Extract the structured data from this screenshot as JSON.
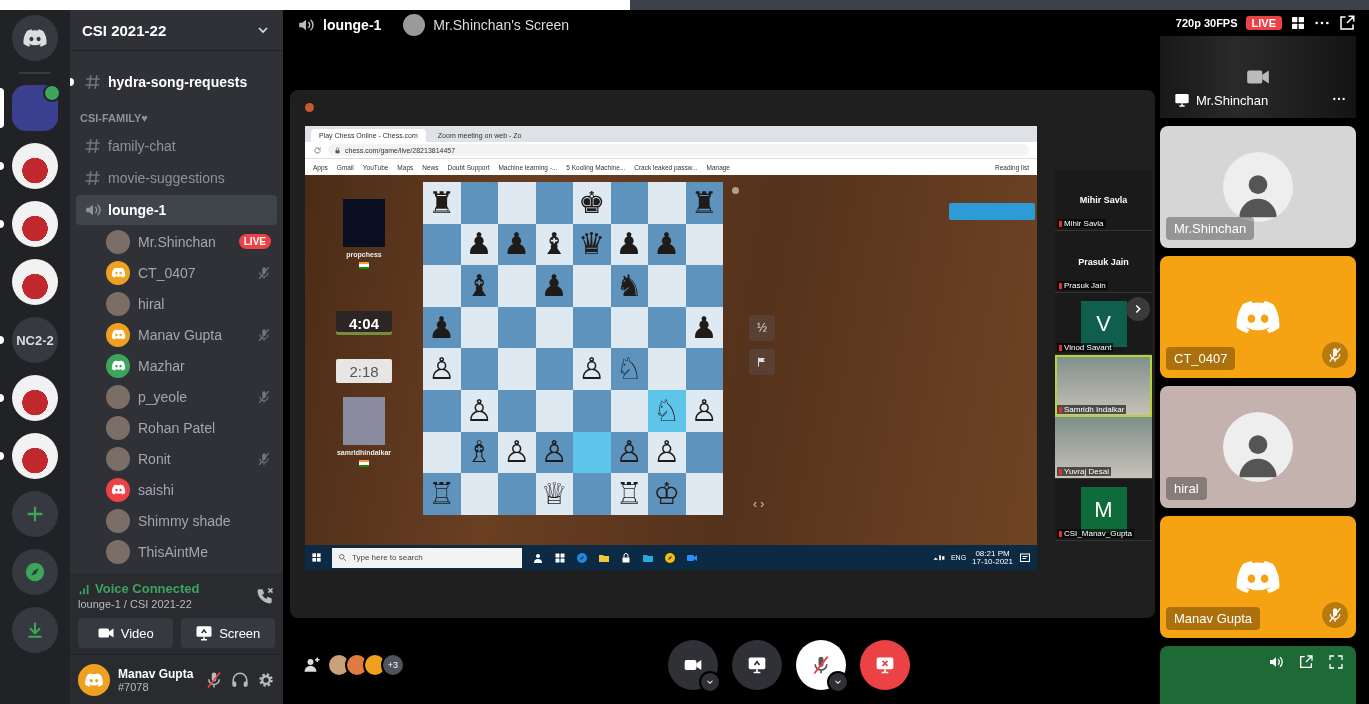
{
  "servers": [
    {
      "kind": "home",
      "selected": false,
      "unread": false,
      "in_voice": false
    },
    {
      "kind": "image",
      "selected": true,
      "unread": false,
      "in_voice": true
    },
    {
      "kind": "image",
      "selected": false,
      "unread": true,
      "in_voice": false
    },
    {
      "kind": "image",
      "selected": false,
      "unread": true,
      "in_voice": false
    },
    {
      "kind": "image",
      "selected": false,
      "unread": false,
      "in_voice": false
    },
    {
      "kind": "text",
      "label": "NC2-2",
      "selected": false,
      "unread": true,
      "in_voice": false
    },
    {
      "kind": "image",
      "selected": false,
      "unread": true,
      "in_voice": false
    },
    {
      "kind": "image",
      "selected": false,
      "unread": true,
      "in_voice": false
    },
    {
      "kind": "add",
      "selected": false,
      "unread": false,
      "in_voice": false
    },
    {
      "kind": "explore",
      "selected": false,
      "unread": false,
      "in_voice": false
    },
    {
      "kind": "download",
      "selected": false,
      "unread": false,
      "in_voice": false
    }
  ],
  "server_name": "CSI 2021-22",
  "channels": [
    {
      "kind": "text",
      "name": "hydra-song-requests",
      "selected": false,
      "unread": true
    }
  ],
  "category": {
    "name": "CSI-FAMILY♥",
    "channels": [
      {
        "kind": "text",
        "name": "family-chat",
        "selected": false,
        "unread": false
      },
      {
        "kind": "text",
        "name": "movie-suggestions",
        "selected": false,
        "unread": false
      },
      {
        "kind": "voice",
        "name": "lounge-1",
        "selected": true,
        "unread": false
      }
    ]
  },
  "members": [
    {
      "name": "Mr.Shinchan",
      "kind": "photo",
      "live": true,
      "live_label": "LIVE",
      "muted": false
    },
    {
      "name": "CT_0407",
      "kind": "discord",
      "color": "#f0a020",
      "live": false,
      "muted": true
    },
    {
      "name": "hiral",
      "kind": "photo",
      "live": false,
      "muted": false
    },
    {
      "name": "Manav Gupta",
      "kind": "discord",
      "color": "#f0a020",
      "live": false,
      "muted": true
    },
    {
      "name": "Mazhar",
      "kind": "discord",
      "color": "#3ba55c",
      "live": false,
      "muted": false
    },
    {
      "name": "p_yeole",
      "kind": "photo",
      "live": false,
      "muted": true
    },
    {
      "name": "Rohan Patel",
      "kind": "photo",
      "live": false,
      "muted": false
    },
    {
      "name": "Ronit",
      "kind": "photo",
      "live": false,
      "muted": true
    },
    {
      "name": "saishi",
      "kind": "discord",
      "color": "#ed4245",
      "live": false,
      "muted": false
    },
    {
      "name": "Shimmy shade",
      "kind": "photo",
      "live": false,
      "muted": false
    },
    {
      "name": "ThisAintMe",
      "kind": "photo",
      "live": false,
      "muted": false
    }
  ],
  "voice_panel": {
    "status": "Voice Connected",
    "channel": "lounge-1 / CSI 2021-22",
    "buttons": [
      {
        "kind": "video",
        "label": "Video"
      },
      {
        "kind": "screen",
        "label": "Screen"
      }
    ]
  },
  "user": {
    "name": "Manav Gupta",
    "tag": "#7078",
    "color": "#f0a020",
    "muted": true
  },
  "header": {
    "channel": "lounge-1",
    "stream_title": "Mr.Shinchan's Screen",
    "quality": "720p 30FPS",
    "live": "LIVE"
  },
  "browser": {
    "tabs": [
      {
        "title": "Play Chess Online - Chess.com",
        "selected": true
      },
      {
        "title": "Zoom meeting on web - Zo",
        "selected": false
      }
    ],
    "url": "chess.com/game/live/28213814457",
    "bookmarks": [
      "Apps",
      "Gmail",
      "YouTube",
      "Maps",
      "News",
      "Doubt Support",
      "Machine learning -...",
      "5 Kooling Machine...",
      "Crack leaked passw...",
      "Manage"
    ],
    "reading_list": "Reading list"
  },
  "chess": {
    "players": [
      {
        "name": "propchess",
        "clock": "4:04",
        "active": false
      },
      {
        "name": "samridhindalkar",
        "clock": "2:18",
        "active": true
      }
    ],
    "draw_button": "½",
    "board": [
      [
        {
          "piece": "♜",
          "highlighted": false
        },
        {
          "highlighted": false
        },
        {
          "highlighted": false
        },
        {
          "highlighted": false
        },
        {
          "piece": "♚",
          "highlighted": false
        },
        {
          "highlighted": false
        },
        {
          "highlighted": false
        },
        {
          "piece": "♜",
          "highlighted": false
        }
      ],
      [
        {
          "highlighted": false
        },
        {
          "piece": "♟",
          "highlighted": false
        },
        {
          "piece": "♟",
          "highlighted": false
        },
        {
          "piece": "♝",
          "highlighted": false
        },
        {
          "piece": "♛",
          "highlighted": false
        },
        {
          "piece": "♟",
          "highlighted": false
        },
        {
          "piece": "♟",
          "highlighted": false
        },
        {
          "highlighted": false
        }
      ],
      [
        {
          "highlighted": false
        },
        {
          "piece": "♝",
          "highlighted": false
        },
        {
          "highlighted": false
        },
        {
          "piece": "♟",
          "highlighted": false
        },
        {
          "highlighted": false
        },
        {
          "piece": "♞",
          "highlighted": false
        },
        {
          "highlighted": false
        },
        {
          "highlighted": false
        }
      ],
      [
        {
          "piece": "♟",
          "highlighted": false
        },
        {
          "highlighted": false
        },
        {
          "highlighted": false
        },
        {
          "highlighted": false
        },
        {
          "highlighted": false
        },
        {
          "highlighted": false
        },
        {
          "highlighted": false
        },
        {
          "piece": "♟",
          "highlighted": false
        }
      ],
      [
        {
          "piece": "♙",
          "highlighted": false
        },
        {
          "highlighted": false
        },
        {
          "highlighted": false
        },
        {
          "highlighted": false
        },
        {
          "piece": "♙",
          "highlighted": false
        },
        {
          "piece": "♘",
          "highlighted": false
        },
        {
          "highlighted": false
        },
        {
          "highlighted": false
        }
      ],
      [
        {
          "highlighted": false
        },
        {
          "piece": "♙",
          "highlighted": false
        },
        {
          "highlighted": false
        },
        {
          "highlighted": false
        },
        {
          "highlighted": false
        },
        {
          "highlighted": false
        },
        {
          "piece": "♘",
          "highlighted": true
        },
        {
          "piece": "♙",
          "highlighted": false
        }
      ],
      [
        {
          "highlighted": false
        },
        {
          "piece": "♗",
          "highlighted": false
        },
        {
          "piece": "♙",
          "highlighted": false
        },
        {
          "piece": "♙",
          "highlighted": false
        },
        {
          "highlighted": true
        },
        {
          "piece": "♙",
          "highlighted": false
        },
        {
          "piece": "♙",
          "highlighted": false
        },
        {
          "highlighted": false
        }
      ],
      [
        {
          "piece": "♖",
          "highlighted": false
        },
        {
          "highlighted": false
        },
        {
          "highlighted": false
        },
        {
          "piece": "♕",
          "highlighted": false
        },
        {
          "highlighted": false
        },
        {
          "piece": "♖",
          "highlighted": false
        },
        {
          "piece": "♔",
          "highlighted": false
        },
        {
          "highlighted": false
        }
      ]
    ],
    "nav": "‹ ›"
  },
  "taskbar": {
    "search_placeholder": "Type here to search",
    "lang": "ENG",
    "time": "08:21 PM",
    "date": "17-10-2021"
  },
  "zoom_panel": [
    {
      "kind": "name",
      "name": "Mihir Savla",
      "label": "Mihir Savla",
      "speaking": false
    },
    {
      "kind": "name",
      "name": "Prasuk Jain",
      "label": "Prasuk Jain",
      "speaking": false
    },
    {
      "kind": "letter",
      "letter": "V",
      "label": "Vinod Savant",
      "color": "#0f5e4e",
      "speaking": false
    },
    {
      "kind": "video",
      "label": "Samridh Indalkar",
      "speaking": true
    },
    {
      "kind": "video",
      "label": "Yuvraj Desai",
      "speaking": false
    },
    {
      "kind": "letter",
      "letter": "M",
      "label": "CSI_Manav_Gupta",
      "color": "#0f6b3a",
      "speaking": false
    }
  ],
  "tiles": [
    {
      "kind": "stream",
      "name": "Mr.Shinchan"
    },
    {
      "kind": "avatar",
      "name": "Mr.Shinchan",
      "color": "#d6d6d6",
      "muted": false
    },
    {
      "kind": "discord",
      "name": "CT_0407",
      "color": "#f6a313",
      "muted": true
    },
    {
      "kind": "avatar",
      "name": "hiral",
      "color": "#c3b2ad",
      "muted": false
    },
    {
      "kind": "discord",
      "name": "Manav Gupta",
      "color": "#f6a313",
      "muted": true
    },
    {
      "kind": "controls",
      "color": "#1e6a36"
    }
  ],
  "bottom": {
    "avatars": [
      {
        "color": "#c9a27c"
      },
      {
        "color": "#e07a40"
      },
      {
        "color": "#f0a020"
      }
    ],
    "extra_count": "+3",
    "controls": [
      {
        "kind": "camera"
      },
      {
        "kind": "screen"
      },
      {
        "kind": "mic",
        "muted": true
      },
      {
        "kind": "end"
      }
    ]
  }
}
